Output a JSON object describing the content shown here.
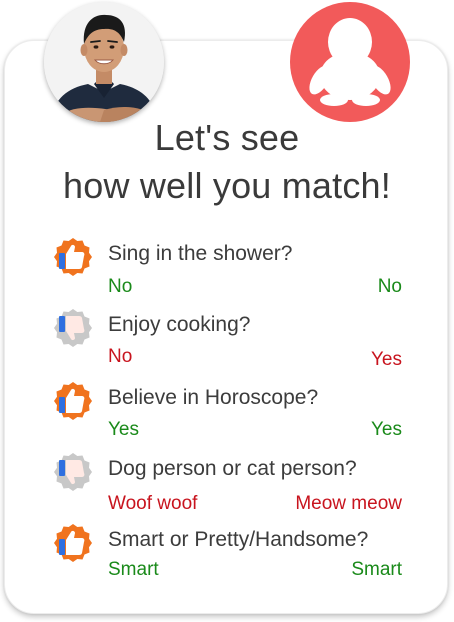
{
  "title": {
    "line1": "Let's see",
    "line2": "how well you match!"
  },
  "avatars": {
    "left": {
      "icon": "user-photo"
    },
    "right": {
      "icon": "penguin-placeholder-icon",
      "color": "#f25a5a"
    }
  },
  "colors": {
    "match": "#1a8a1a",
    "mismatch": "#c8141e",
    "like_orange": "#f0731e",
    "like_blue": "#2f6fe0",
    "dislike_gray": "#c8c8c8"
  },
  "questions": [
    {
      "text": "Sing in the shower?",
      "left_answer": "No",
      "right_answer": "No",
      "result": "match",
      "icon": "thumbs-up-badge-icon"
    },
    {
      "text": "Enjoy cooking?",
      "left_answer": "No",
      "right_answer": "Yes",
      "result": "mismatch",
      "icon": "thumbs-down-badge-icon"
    },
    {
      "text": "Believe in Horoscope?",
      "left_answer": "Yes",
      "right_answer": "Yes",
      "result": "match",
      "icon": "thumbs-up-badge-icon"
    },
    {
      "text": "Dog person or cat person?",
      "left_answer": "Woof woof",
      "right_answer": "Meow meow",
      "result": "mismatch",
      "icon": "thumbs-down-badge-icon"
    },
    {
      "text": "Smart or Pretty/Handsome?",
      "left_answer": "Smart",
      "right_answer": "Smart",
      "result": "match",
      "icon": "thumbs-up-badge-icon"
    }
  ]
}
